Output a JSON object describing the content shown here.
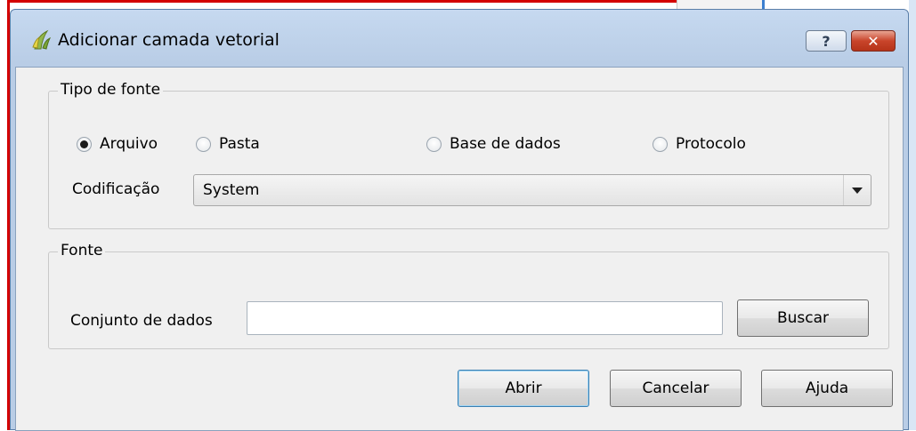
{
  "window": {
    "title": "Adicionar camada vetorial",
    "help_button": "?",
    "close_button": "✕"
  },
  "source_type": {
    "group_title": "Tipo de fonte",
    "options": [
      {
        "label": "Arquivo",
        "selected": true
      },
      {
        "label": "Pasta",
        "selected": false
      },
      {
        "label": "Base de dados",
        "selected": false
      },
      {
        "label": "Protocolo",
        "selected": false
      }
    ],
    "encoding_label": "Codificação",
    "encoding_value": "System"
  },
  "source": {
    "group_title": "Fonte",
    "dataset_label": "Conjunto de dados",
    "dataset_value": "",
    "browse_label": "Buscar"
  },
  "actions": {
    "open_label": "Abrir",
    "cancel_label": "Cancelar",
    "help_label": "Ajuda"
  },
  "colors": {
    "title_bar": "#b9cde6",
    "close_button": "#c9452b",
    "dialog_background": "#f0f0f0",
    "default_button_border": "#3c7fb1"
  },
  "icons": {
    "app": "qgis-icon",
    "dropdown": "chevron-down-icon"
  }
}
